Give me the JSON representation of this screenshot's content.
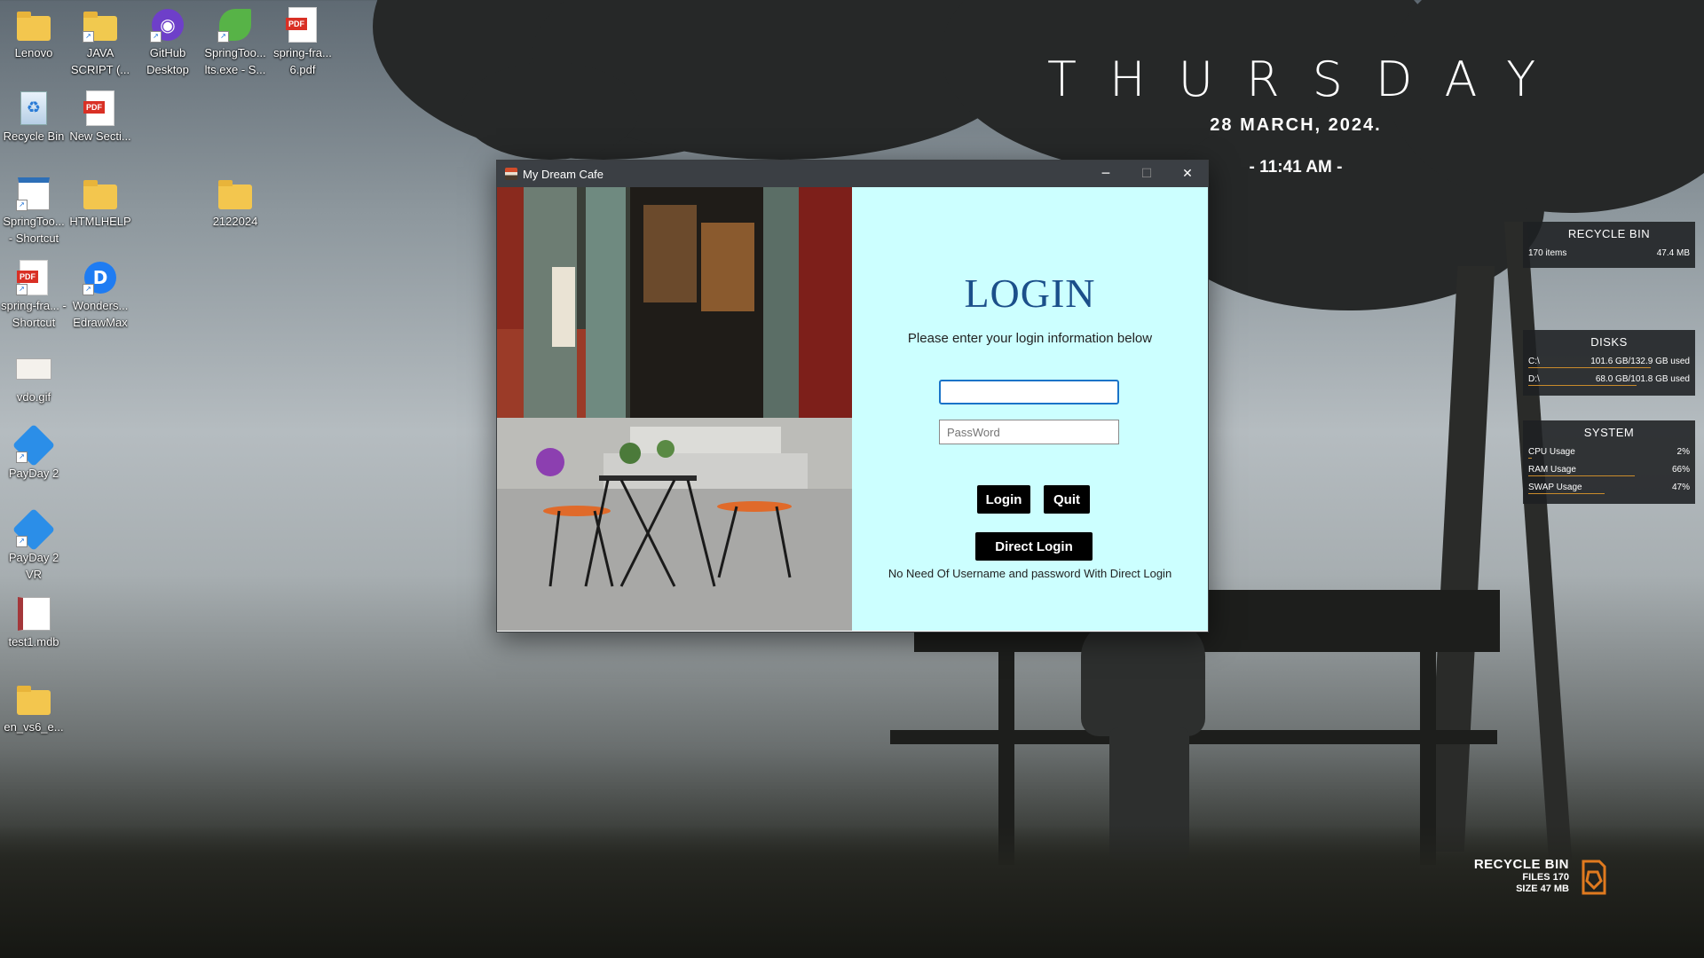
{
  "desktop": {
    "icons": [
      {
        "label": "Lenovo",
        "type": "folder-icon"
      },
      {
        "label": "JAVA SCRIPT (...",
        "type": "folder-icon"
      },
      {
        "label": "GitHub Desktop",
        "type": "github-icon"
      },
      {
        "label": "SpringToo... lts.exe - S...",
        "type": "spring-icon"
      },
      {
        "label": "spring-fra... 6.pdf",
        "type": "pdf-icon",
        "badge": "PDF"
      },
      {
        "label": "Recycle Bin",
        "type": "recycle-bin-icon"
      },
      {
        "label": "New Secti...",
        "type": "pdf-icon",
        "badge": "PDF"
      },
      {
        "label": "SpringToo... - Shortcut",
        "type": "shortcut-icon"
      },
      {
        "label": "HTMLHELP",
        "type": "folder-icon"
      },
      {
        "label": "2122024",
        "type": "folder-icon"
      },
      {
        "label": "spring-fra... - Shortcut",
        "type": "pdf-icon",
        "badge": "PDF"
      },
      {
        "label": "Wonders... EdrawMax",
        "type": "edrawmax-icon"
      },
      {
        "label": "vdo.gif",
        "type": "gif-icon"
      },
      {
        "label": "PayDay 2",
        "type": "payday-icon"
      },
      {
        "label": "PayDay 2 VR",
        "type": "payday-icon"
      },
      {
        "label": "test1.mdb",
        "type": "database-icon"
      },
      {
        "label": "en_vs6_e...",
        "type": "folder-icon"
      }
    ]
  },
  "clock": {
    "day": "THURSDAY",
    "date": "28 MARCH, 2024.",
    "time": "- 11:41 AM -"
  },
  "widgets": {
    "recycle_bin": {
      "title": "RECYCLE BIN",
      "items": "170 items",
      "size": "47.4 MB"
    },
    "disks": {
      "title": "DISKS",
      "rows": [
        {
          "drive": "C:\\",
          "usage": "101.6 GB/132.9 GB used",
          "fraction": 0.76
        },
        {
          "drive": "D:\\",
          "usage": "68.0 GB/101.8 GB used",
          "fraction": 0.67
        }
      ]
    },
    "system": {
      "title": "SYSTEM",
      "rows": [
        {
          "label": "CPU Usage",
          "value": "2%",
          "fraction": 0.02
        },
        {
          "label": "RAM Usage",
          "value": "66%",
          "fraction": 0.66
        },
        {
          "label": "SWAP Usage",
          "value": "47%",
          "fraction": 0.47
        }
      ]
    },
    "recycle_corner": {
      "title": "RECYCLE BIN",
      "files": "FILES 170",
      "size": "SIZE 47 MB"
    }
  },
  "window": {
    "title": "My Dream Cafe",
    "controls": {
      "minimize": "─",
      "maximize": "☐",
      "close": "✕"
    },
    "heading": "LOGIN",
    "subtitle": "Please enter your login information below",
    "username": {
      "value": "",
      "placeholder": ""
    },
    "password": {
      "value": "",
      "placeholder": "PassWord"
    },
    "buttons": {
      "login": "Login",
      "quit": "Quit",
      "direct_login": "Direct Login"
    },
    "note": "No Need Of Username and password With Direct Login",
    "colors": {
      "form_bg": "#ccffff",
      "heading": "#1b4f8a",
      "button_bg": "#000000"
    }
  }
}
